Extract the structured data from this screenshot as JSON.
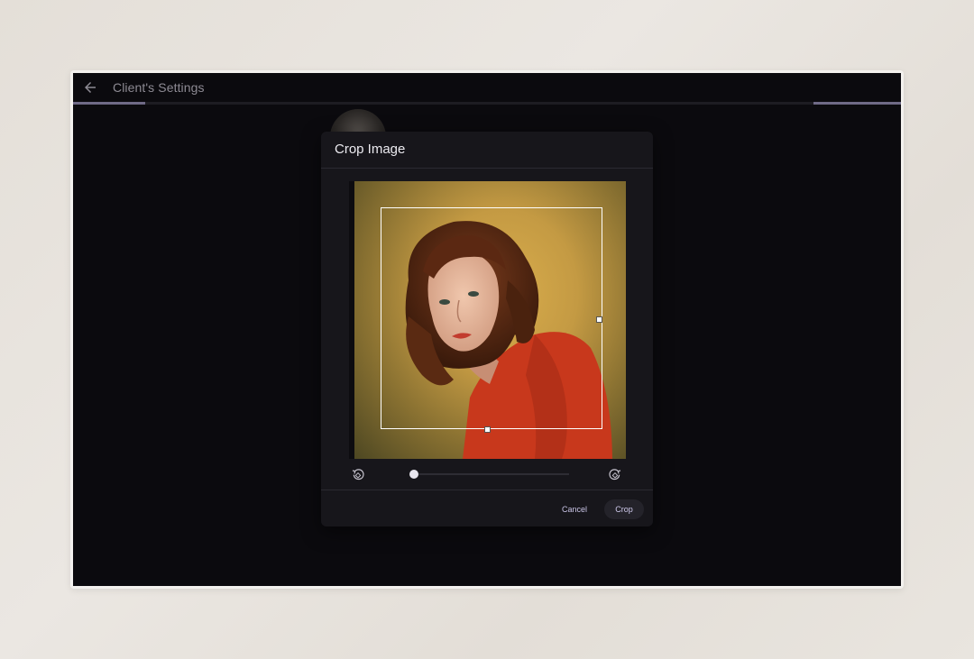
{
  "window": {
    "title": "Client's Settings",
    "progress_fraction_left": 0.087,
    "progress_fraction_right": 0.106
  },
  "dialog": {
    "title": "Crop Image",
    "zoom_slider_value": 0.02,
    "cancel_label": "Cancel",
    "crop_label": "Crop"
  },
  "icons": {
    "back": "arrow-left-icon",
    "rotate_left": "rotate-left-icon",
    "rotate_right": "rotate-right-icon"
  },
  "colors": {
    "screen_bg": "#0b0a0e",
    "dialog_bg": "#17161b",
    "accent": "#6f6a86",
    "button_text": "#c9c4e6"
  }
}
